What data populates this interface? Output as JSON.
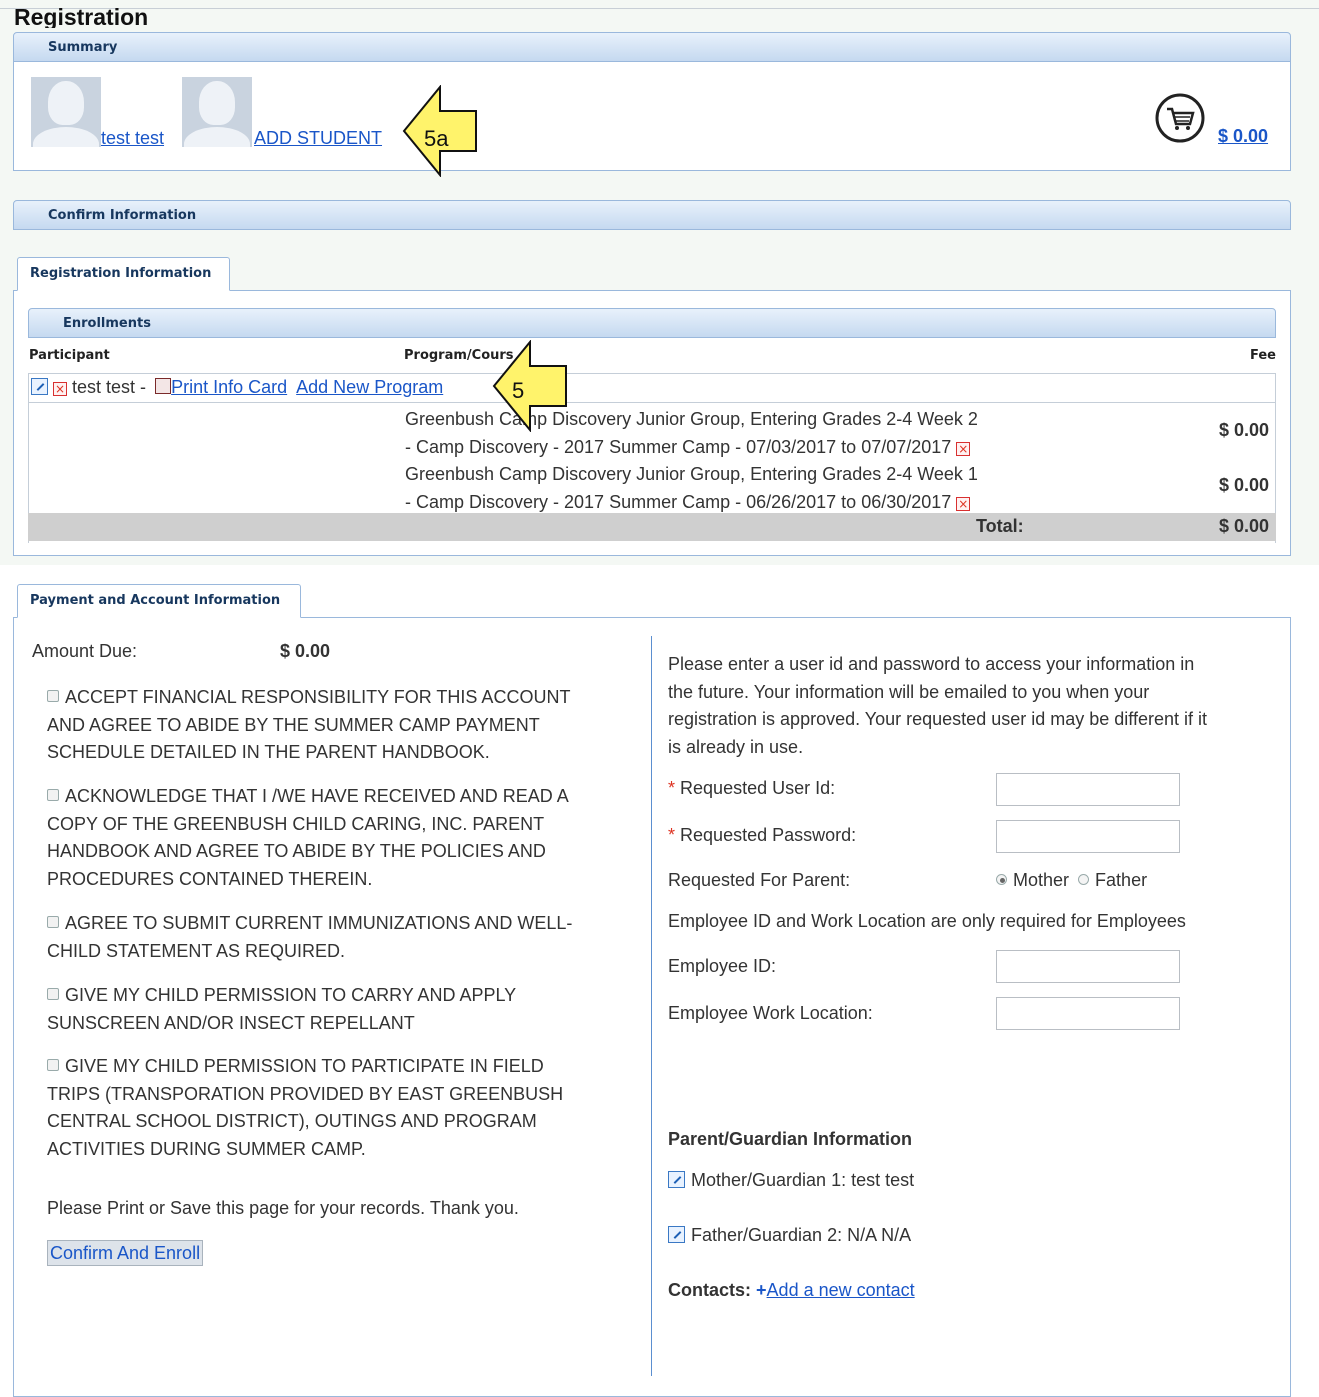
{
  "page": {
    "title": "Registration"
  },
  "summary": {
    "panel_title": "Summary",
    "students": [
      {
        "name": "test test"
      },
      {
        "name": "ADD STUDENT"
      }
    ],
    "cart_total": "$ 0.00",
    "cart_icon": "shopping-cart-icon"
  },
  "confirm": {
    "panel_title": "Confirm Information"
  },
  "registration": {
    "tab_label": "Registration Information",
    "enrollments": {
      "panel_title": "Enrollments",
      "columns": {
        "participant": "Participant",
        "program": "Program/Course",
        "fee": "Fee"
      },
      "participant_row": {
        "name": "test test -",
        "print_card": "Print Info Card",
        "add_program": "Add New Program"
      },
      "programs": [
        {
          "line1": "Greenbush Camp Discovery Junior Group, Entering Grades 2-4 Week 2",
          "line2": "- Camp Discovery - 2017 Summer Camp - 07/03/2017 to 07/07/2017",
          "fee": "$ 0.00"
        },
        {
          "line1": "Greenbush Camp Discovery Junior Group, Entering Grades 2-4 Week 1",
          "line2": "- Camp Discovery - 2017 Summer Camp - 06/26/2017 to 06/30/2017",
          "fee": "$ 0.00"
        }
      ],
      "total_label": "Total:",
      "total_value": "$ 0.00"
    }
  },
  "payment": {
    "tab_label": "Payment and Account Information",
    "amount_due_label": "Amount Due:",
    "amount_due_value": "$ 0.00",
    "agreements": [
      {
        "lines": [
          "ACCEPT FINANCIAL RESPONSIBILITY FOR THIS ACCOUNT",
          "AND AGREE TO ABIDE BY THE SUMMER CAMP PAYMENT",
          "SCHEDULE DETAILED IN THE PARENT HANDBOOK."
        ]
      },
      {
        "lines": [
          "ACKNOWLEDGE THAT I /WE HAVE RECEIVED AND READ A",
          "COPY OF THE GREENBUSH CHILD CARING, INC. PARENT",
          "HANDBOOK AND AGREE TO ABIDE BY THE POLICIES AND",
          "PROCEDURES CONTAINED THEREIN."
        ]
      },
      {
        "lines": [
          "AGREE TO SUBMIT CURRENT IMMUNIZATIONS AND WELL-",
          "CHILD STATEMENT AS REQUIRED."
        ]
      },
      {
        "lines": [
          "GIVE MY CHILD PERMISSION TO CARRY AND APPLY",
          "SUNSCREEN AND/OR INSECT REPELLANT"
        ]
      },
      {
        "lines": [
          "GIVE MY CHILD PERMISSION TO PARTICIPATE IN FIELD",
          "TRIPS (TRANSPORATION PROVIDED BY EAST GREENBUSH",
          "CENTRAL SCHOOL DISTRICT), OUTINGS AND PROGRAM",
          "ACTIVITIES DURING SUMMER CAMP."
        ]
      }
    ],
    "print_note": "Please Print or Save this page for your records. Thank you.",
    "confirm_button": "Confirm And Enroll",
    "account": {
      "intro_lines": [
        "Please enter a user id and password to access your information in",
        "the future. Your information will be emailed to you when your",
        "registration is approved. Your requested user id may be different if it",
        "is already in use."
      ],
      "required_mark": "*",
      "user_id_label": "Requested User Id:",
      "password_label": "Requested Password:",
      "parent_label": "Requested For Parent:",
      "parent_options": [
        "Mother",
        "Father"
      ],
      "employee_note": "Employee ID and Work Location are only required for Employees",
      "employee_id_label": "Employee ID:",
      "work_location_label": "Employee Work Location:",
      "user_id_value": "",
      "password_value": "",
      "employee_id_value": "",
      "work_location_value": ""
    },
    "guardian": {
      "title": "Parent/Guardian Information",
      "mother": "Mother/Guardian 1: test test",
      "father": "Father/Guardian 2: N/A N/A",
      "contacts_label": "Contacts:",
      "add_contact": "Add a new contact"
    }
  },
  "annotations": {
    "a1": "5a",
    "a2": "5",
    "color": "#fff36b"
  }
}
